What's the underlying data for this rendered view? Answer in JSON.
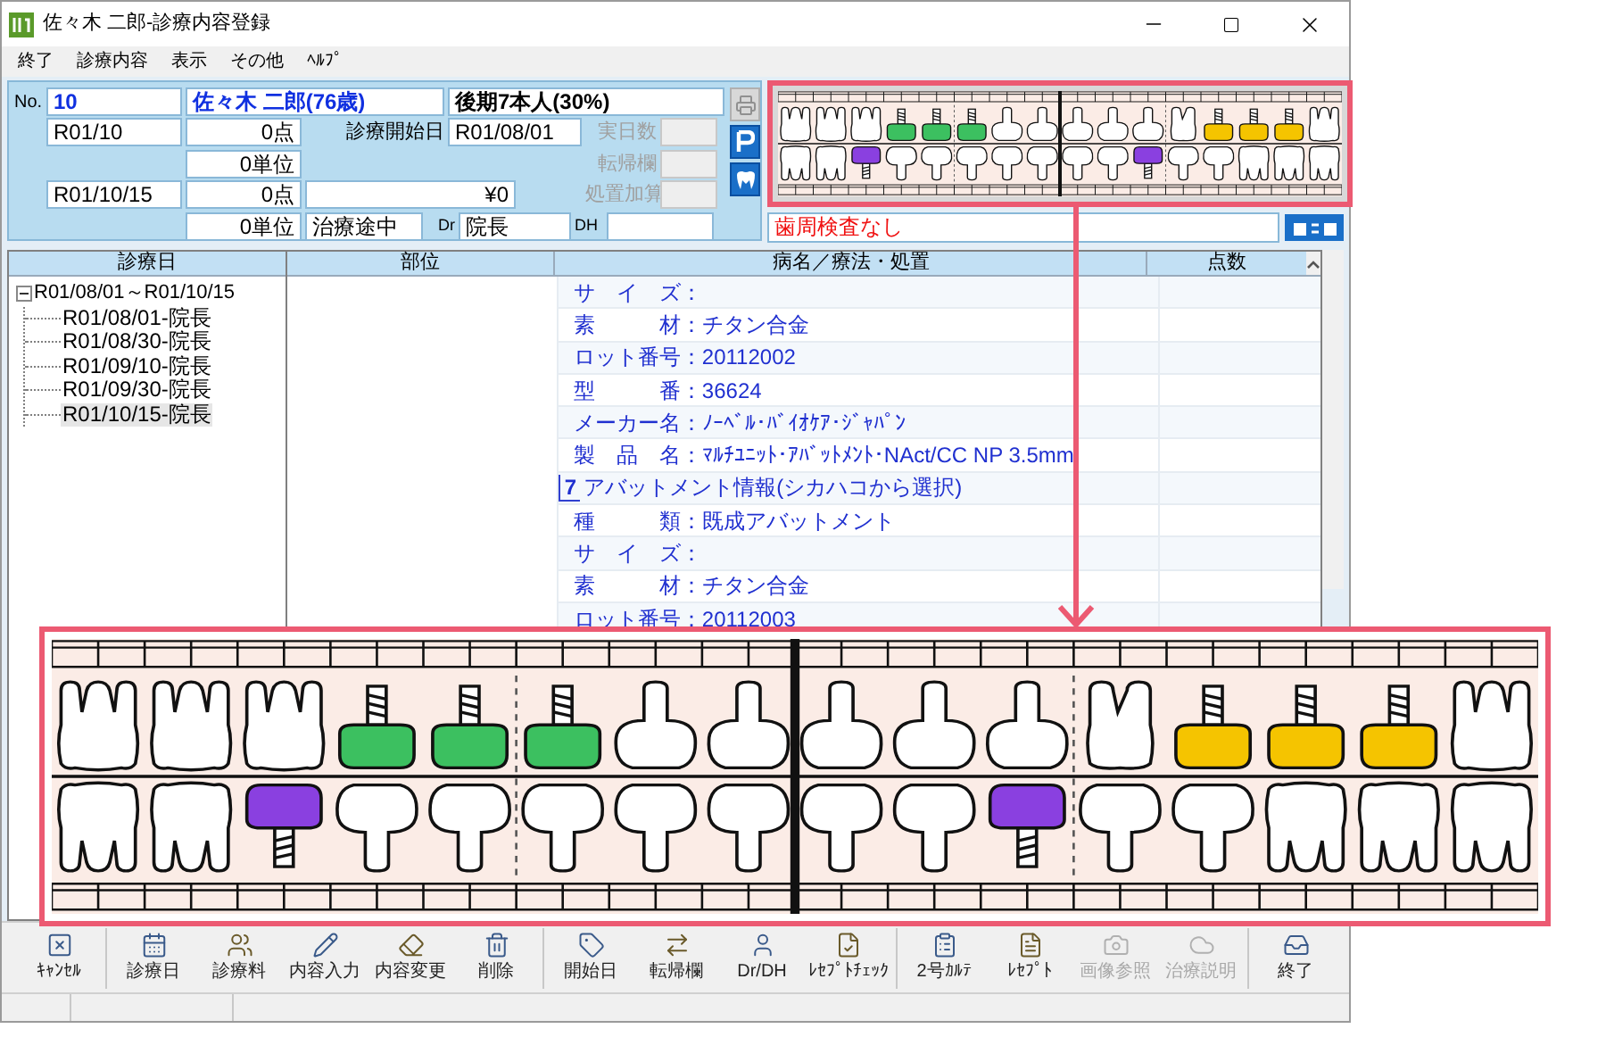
{
  "window": {
    "title": "佐々木 二郎-診療内容登録"
  },
  "menu": [
    "終了",
    "診療内容",
    "表示",
    "その他",
    "ﾍﾙﾌﾟ"
  ],
  "patient": {
    "no_label": "No.",
    "no": "10",
    "name": "佐々木 二郎(76歳)",
    "insurance": "後期7本人(30%)",
    "month": "R01/10",
    "month_points": "0点",
    "month_units": "0単位",
    "start_label": "診療開始日",
    "start_date": "R01/08/01",
    "visit_date": "R01/10/15",
    "visit_points": "0点",
    "visit_units": "0単位",
    "charge": "¥0",
    "status": "治療途中",
    "dr_label": "Dr",
    "dr": "院長",
    "dh_label": "DH",
    "side_fields": [
      {
        "label": "実日数",
        "disabled": true
      },
      {
        "label": "転帰欄",
        "disabled": true
      },
      {
        "label": "処置加算",
        "disabled": true
      }
    ]
  },
  "side_buttons": [
    {
      "disabled": true
    },
    {
      "disabled": false
    },
    {
      "disabled": false
    }
  ],
  "perio": {
    "value": "歯周検査なし"
  },
  "teeth": {
    "upper": [
      {
        "kind": "molar"
      },
      {
        "kind": "molar"
      },
      {
        "kind": "molar"
      },
      {
        "kind": "implant",
        "color": "#3cc060"
      },
      {
        "kind": "implant",
        "color": "#3cc060"
      },
      {
        "kind": "implant",
        "color": "#3cc060"
      },
      {
        "kind": "anterior"
      },
      {
        "kind": "anterior"
      },
      {
        "kind": "anterior"
      },
      {
        "kind": "anterior"
      },
      {
        "kind": "anterior"
      },
      {
        "kind": "premolar"
      },
      {
        "kind": "implant",
        "color": "#f5c400"
      },
      {
        "kind": "implant",
        "color": "#f5c400"
      },
      {
        "kind": "implant",
        "color": "#f5c400"
      },
      {
        "kind": "molar"
      }
    ],
    "lower": [
      {
        "kind": "molar"
      },
      {
        "kind": "molar"
      },
      {
        "kind": "implant",
        "color": "#8a40e0"
      },
      {
        "kind": "anterior"
      },
      {
        "kind": "anterior"
      },
      {
        "kind": "anterior"
      },
      {
        "kind": "anterior"
      },
      {
        "kind": "anterior"
      },
      {
        "kind": "anterior"
      },
      {
        "kind": "anterior"
      },
      {
        "kind": "implant",
        "color": "#8a40e0"
      },
      {
        "kind": "anterior"
      },
      {
        "kind": "anterior"
      },
      {
        "kind": "molar"
      },
      {
        "kind": "molar"
      },
      {
        "kind": "molar"
      }
    ]
  },
  "tree": {
    "header": "診療日",
    "root": {
      "label": "R01/08/01～R01/10/15",
      "expanded": true,
      "selected": false,
      "children": [
        {
          "label": "R01/08/01-院長",
          "selected": false
        },
        {
          "label": "R01/08/30-院長",
          "selected": false
        },
        {
          "label": "R01/09/10-院長",
          "selected": false
        },
        {
          "label": "R01/09/30-院長",
          "selected": false
        },
        {
          "label": "R01/10/15-院長",
          "selected": true
        }
      ]
    }
  },
  "table": {
    "columns": [
      "部位",
      "病名／療法・処置",
      "点数"
    ],
    "rows": [
      {
        "kind": "item",
        "text": "サ　イ　ズ："
      },
      {
        "kind": "item",
        "text": "素　　　材：チタン合金"
      },
      {
        "kind": "item",
        "text": "ロット番号：20112002"
      },
      {
        "kind": "item",
        "text": "型　　　番：36624"
      },
      {
        "kind": "item",
        "text": "メーカー名：ﾉｰﾍﾞﾙ･ﾊﾞｲｵｹｱ･ｼﾞｬﾊﾟﾝ"
      },
      {
        "kind": "item",
        "text": "製　品　名：ﾏﾙﾁﾕﾆｯﾄ･ｱﾊﾞｯﾄﾒﾝﾄ･NAct/CC NP 3.5mm"
      },
      {
        "kind": "group",
        "number": "7",
        "text": "アバットメント情報(シカハコから選択)"
      },
      {
        "kind": "item",
        "text": "種　　　類：既成アバットメント"
      },
      {
        "kind": "item",
        "text": "サ　イ　ズ："
      },
      {
        "kind": "item",
        "text": "素　　　材：チタン合金"
      },
      {
        "kind": "item",
        "text": "ロット番号：20112003"
      }
    ]
  },
  "toolbar": [
    {
      "items": [
        {
          "label": "ｷｬﾝｾﾙ",
          "disabled": false
        }
      ]
    },
    {
      "items": [
        {
          "label": "診療日",
          "disabled": false
        },
        {
          "label": "診療料",
          "disabled": false
        },
        {
          "label": "内容入力",
          "disabled": false
        },
        {
          "label": "内容変更",
          "disabled": false
        },
        {
          "label": "削除",
          "disabled": false
        }
      ]
    },
    {
      "items": [
        {
          "label": "開始日",
          "disabled": false
        },
        {
          "label": "転帰欄",
          "disabled": false
        },
        {
          "label": "Dr/DH",
          "disabled": false
        },
        {
          "label": "ﾚｾﾌﾟﾄﾁｪｯｸ",
          "disabled": false
        }
      ]
    },
    {
      "items": [
        {
          "label": "2号ｶﾙﾃ",
          "disabled": false
        },
        {
          "label": "ﾚｾﾌﾟﾄ",
          "disabled": false
        },
        {
          "label": "画像参照",
          "disabled": true
        },
        {
          "label": "治療説明",
          "disabled": true
        }
      ]
    },
    {
      "items": [
        {
          "label": "終了",
          "disabled": false
        }
      ]
    }
  ]
}
